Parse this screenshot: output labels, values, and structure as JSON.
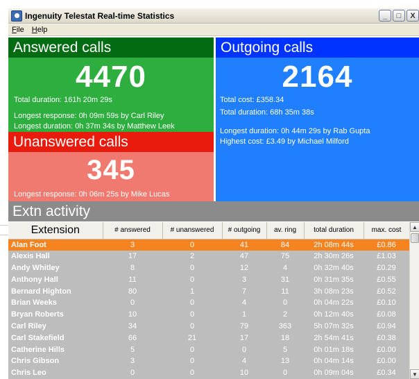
{
  "window": {
    "title": "Ingenuity Telestat Real-time Statistics",
    "app_icon": "telestat-app-icon",
    "buttons": {
      "minimize": "_",
      "maximize": "□",
      "close": "X"
    }
  },
  "menu": {
    "items": [
      {
        "label": "File"
      },
      {
        "label": "Help"
      }
    ]
  },
  "answered": {
    "title": "Answered calls",
    "count": "4470",
    "total_duration": "Total duration: 161h 20m 29s",
    "longest_response": "Longest response: 0h 09m 59s by Carl Riley",
    "longest_duration": "Longest duration: 0h 37m 34s by Matthew Leek"
  },
  "unanswered": {
    "title": "Unanswered calls",
    "count": "345",
    "longest_response": "Longest response: 0h 06m 25s by Mike Lucas"
  },
  "outgoing": {
    "title": "Outgoing calls",
    "count": "2164",
    "total_cost": "Total cost: £358.34",
    "total_duration": "Total duration: 68h 35m 38s",
    "longest_duration": "Longest duration: 0h 44m 29s by Rab Gupta",
    "highest_cost": "Highest cost: £3.49 by Michael Milford"
  },
  "extn": {
    "title": "Extn activity",
    "columns": [
      "Extension",
      "# answered",
      "# unanswered",
      "# outgoing",
      "av. ring",
      "total duration",
      "max. cost"
    ],
    "rows": [
      [
        "Alan Foot",
        "3",
        "0",
        "41",
        "84",
        "2h 08m 44s",
        "£0.86"
      ],
      [
        "Alexis Hall",
        "17",
        "2",
        "47",
        "75",
        "2h 30m 26s",
        "£1.03"
      ],
      [
        "Andy Whitley",
        "8",
        "0",
        "12",
        "4",
        "0h 32m 40s",
        "£0.29"
      ],
      [
        "Anthony Hall",
        "11",
        "0",
        "3",
        "31",
        "0h 31m 35s",
        "£0.55"
      ],
      [
        "Bernard Highton",
        "80",
        "1",
        "7",
        "11",
        "3h 08m 23s",
        "£0.52"
      ],
      [
        "Brian Weeks",
        "0",
        "0",
        "4",
        "0",
        "0h 04m 22s",
        "£0.10"
      ],
      [
        "Bryan Roberts",
        "10",
        "0",
        "1",
        "2",
        "0h 12m 40s",
        "£0.08"
      ],
      [
        "Carl Riley",
        "34",
        "0",
        "79",
        "363",
        "5h 07m 32s",
        "£0.94"
      ],
      [
        "Carl Stakefield",
        "66",
        "21",
        "17",
        "18",
        "2h 54m 41s",
        "£0.38"
      ],
      [
        "Catherine Hills",
        "5",
        "0",
        "0",
        "5",
        "0h 01m 18s",
        "£0.00"
      ],
      [
        "Chris Gibson",
        "3",
        "0",
        "4",
        "13",
        "0h 04m 14s",
        "£0.00"
      ],
      [
        "Chris Leo",
        "0",
        "0",
        "10",
        "0",
        "0h 09m 04s",
        "£0.34"
      ]
    ],
    "selected_row": 0
  },
  "colors": {
    "answered_bg": "#2eae3e",
    "answered_header": "#036b11",
    "unanswered_bg": "#f17a70",
    "unanswered_header": "#e81b0d",
    "outgoing_bg": "#1f7fff",
    "outgoing_header": "#0033ff",
    "extn_header": "#8b8b8b",
    "row_bg": "#bdbdbd",
    "selected_row": "#f58320"
  }
}
